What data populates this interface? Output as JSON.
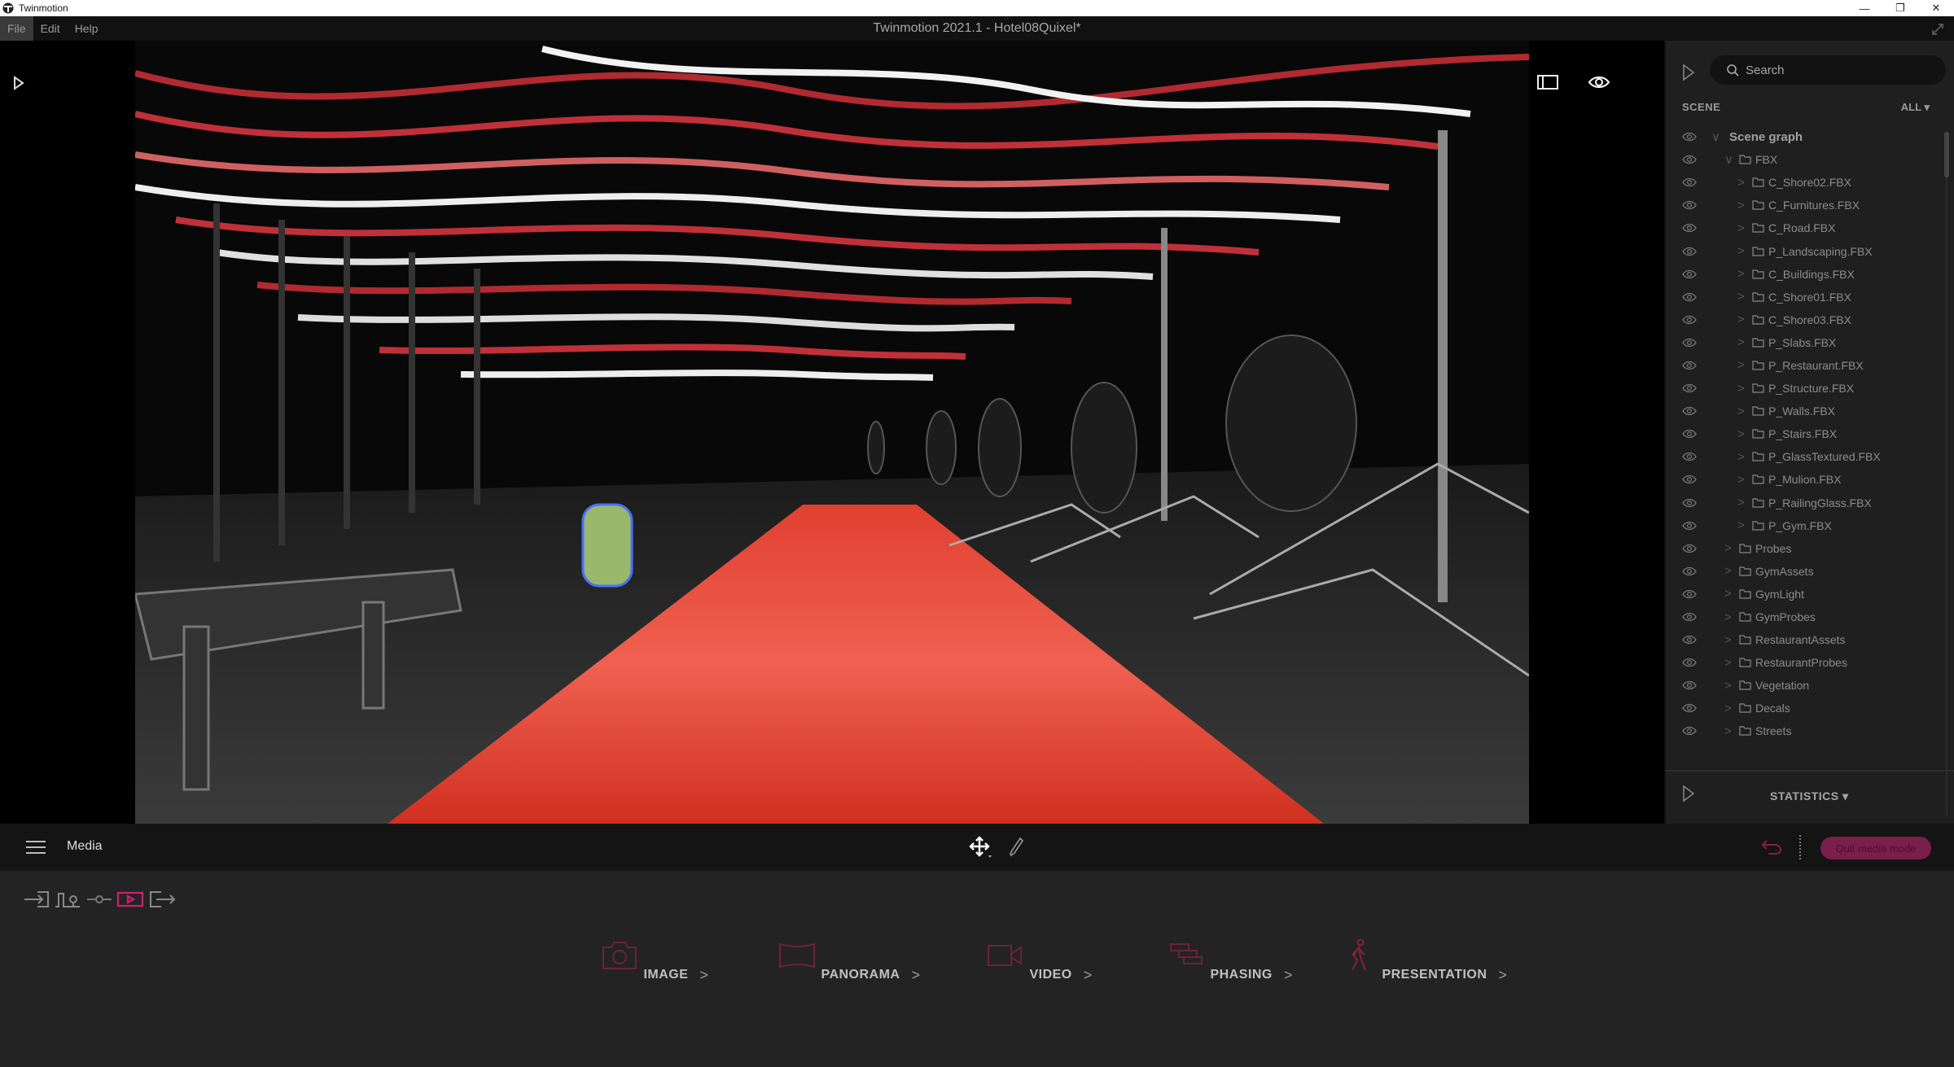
{
  "window": {
    "app_name": "Twinmotion",
    "title": "Twinmotion 2021.1 - Hotel08Quixel*",
    "controls": {
      "minimize": "—",
      "maximize": "❐",
      "close": "✕"
    }
  },
  "menu": [
    {
      "label": "File",
      "active": true
    },
    {
      "label": "Edit"
    },
    {
      "label": "Help"
    }
  ],
  "right_panel": {
    "search_placeholder": "Search",
    "scene_label": "SCENE",
    "filter_label": "ALL",
    "statistics_label": "STATISTICS",
    "tree": [
      {
        "label": "Scene graph",
        "level": 0,
        "expanded": true,
        "folder": false
      },
      {
        "label": "FBX",
        "level": 1,
        "expanded": true,
        "folder": true
      },
      {
        "label": "C_Shore02.FBX",
        "level": 2,
        "folder": true
      },
      {
        "label": "C_Furnitures.FBX",
        "level": 2,
        "folder": true
      },
      {
        "label": "C_Road.FBX",
        "level": 2,
        "folder": true
      },
      {
        "label": "P_Landscaping.FBX",
        "level": 2,
        "folder": true
      },
      {
        "label": "C_Buildings.FBX",
        "level": 2,
        "folder": true
      },
      {
        "label": "C_Shore01.FBX",
        "level": 2,
        "folder": true
      },
      {
        "label": "C_Shore03.FBX",
        "level": 2,
        "folder": true
      },
      {
        "label": "P_Slabs.FBX",
        "level": 2,
        "folder": true
      },
      {
        "label": "P_Restaurant.FBX",
        "level": 2,
        "folder": true
      },
      {
        "label": "P_Structure.FBX",
        "level": 2,
        "folder": true
      },
      {
        "label": "P_Walls.FBX",
        "level": 2,
        "folder": true
      },
      {
        "label": "P_Stairs.FBX",
        "level": 2,
        "folder": true
      },
      {
        "label": "P_GlassTextured.FBX",
        "level": 2,
        "folder": true
      },
      {
        "label": "P_Mulion.FBX",
        "level": 2,
        "folder": true
      },
      {
        "label": "P_RailingGlass.FBX",
        "level": 2,
        "folder": true
      },
      {
        "label": "P_Gym.FBX",
        "level": 2,
        "folder": true
      },
      {
        "label": "Probes",
        "level": 1,
        "folder": true
      },
      {
        "label": "GymAssets",
        "level": 1,
        "folder": true
      },
      {
        "label": "GymLight",
        "level": 1,
        "folder": true
      },
      {
        "label": "GymProbes",
        "level": 1,
        "folder": true
      },
      {
        "label": "RestaurantAssets",
        "level": 1,
        "folder": true
      },
      {
        "label": "RestaurantProbes",
        "level": 1,
        "folder": true
      },
      {
        "label": "Vegetation",
        "level": 1,
        "folder": true
      },
      {
        "label": "Decals",
        "level": 1,
        "folder": true
      },
      {
        "label": "Streets",
        "level": 1,
        "folder": true
      }
    ]
  },
  "toolbar": {
    "mode_label": "Media",
    "quit_label": "Quit media mode"
  },
  "media_items": [
    {
      "label": "IMAGE",
      "icon": "camera-icon"
    },
    {
      "label": "PANORAMA",
      "icon": "panorama-icon"
    },
    {
      "label": "VIDEO",
      "icon": "video-camera-icon"
    },
    {
      "label": "PHASING",
      "icon": "phasing-icon"
    },
    {
      "label": "PRESENTATION",
      "icon": "walking-person-icon"
    }
  ],
  "side_tools": [
    "import-icon",
    "context-icon",
    "configuration-icon",
    "media-icon",
    "export-icon"
  ],
  "colors": {
    "accent": "#c2185b",
    "accent_dim": "#7a1e4c",
    "icon_dim": "#6b2238"
  }
}
